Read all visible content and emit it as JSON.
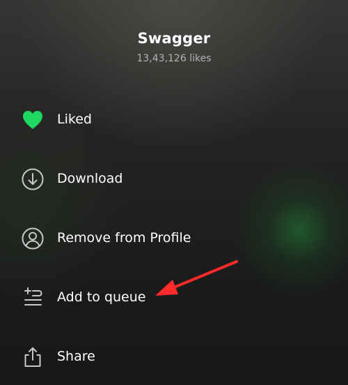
{
  "track": {
    "title": "Swagger",
    "likes": "13,43,126 likes"
  },
  "menu": [
    {
      "label": "Liked",
      "icon": "heart-filled-icon",
      "color": "#1ed760"
    },
    {
      "label": "Download",
      "icon": "download-icon"
    },
    {
      "label": "Remove from Profile",
      "icon": "profile-icon"
    },
    {
      "label": "Add to queue",
      "icon": "add-to-queue-icon"
    },
    {
      "label": "Share",
      "icon": "share-icon"
    }
  ],
  "annotation": {
    "arrow_color": "#ff2a2a",
    "points_to": "Add to queue"
  }
}
